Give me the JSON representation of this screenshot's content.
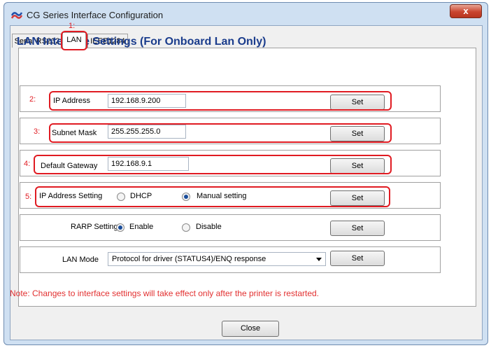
{
  "window": {
    "title": "CG Series Interface Configuration",
    "close_label": "x"
  },
  "tabs": [
    {
      "label": "Serial RS232"
    },
    {
      "label": "LAN"
    },
    {
      "label": "IEEE1284"
    }
  ],
  "heading": "LAN Interface Settings (For Onboard Lan Only)",
  "fields": {
    "ip": {
      "number": "2:",
      "label": "IP Address",
      "value": "192.168.9.200",
      "button": "Set"
    },
    "subnet": {
      "number": "3:",
      "label": "Subnet Mask",
      "value": "255.255.255.0",
      "button": "Set"
    },
    "gateway": {
      "number": "4:",
      "label": "Default Gateway",
      "value": "192.168.9.1",
      "button": "Set"
    },
    "ip_setting": {
      "number": "5:",
      "label": "IP Address Setting",
      "option1": "DHCP",
      "option2": "Manual setting",
      "selected": "Manual setting",
      "button": "Set"
    },
    "rarp": {
      "label": "RARP Setting",
      "option1": "Enable",
      "option2": "Disable",
      "selected": "Enable",
      "button": "Set"
    },
    "lan_mode": {
      "label": "LAN Mode",
      "value": "Protocol for driver (STATUS4)/ENQ response",
      "button": "Set"
    }
  },
  "tab_annotation": "1:",
  "note": "Note: Changes to interface settings will take effect only after the printer is restarted.",
  "close_button": "Close",
  "colors": {
    "accent_red": "#e01b22",
    "heading_blue": "#1a3c8c",
    "note_red": "#e23030"
  }
}
